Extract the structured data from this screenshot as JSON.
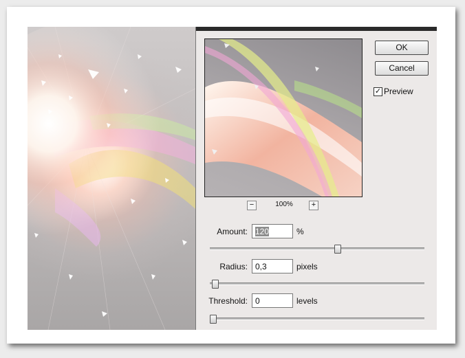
{
  "dialog": {
    "buttons": {
      "ok": "OK",
      "cancel": "Cancel"
    },
    "preview": {
      "label": "Preview",
      "checked": true
    },
    "zoom": {
      "minus": "−",
      "value": "100%",
      "plus": "+"
    },
    "fields": [
      {
        "label": "Amount:",
        "value": "120",
        "unit": "%",
        "slider_fraction": 0.6
      },
      {
        "label": "Radius:",
        "value": "0,3",
        "unit": "pixels",
        "slider_fraction": 0.01
      },
      {
        "label": "Threshold:",
        "value": "0",
        "unit": "levels",
        "slider_fraction": 0.0
      }
    ]
  },
  "icons": {
    "check": "check-icon",
    "minus": "minus-icon",
    "plus": "plus-icon"
  }
}
